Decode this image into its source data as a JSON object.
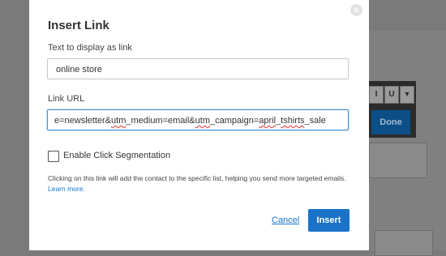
{
  "background": {
    "format_buttons": [
      "I",
      "U",
      "▾"
    ],
    "done_label": "Done"
  },
  "modal": {
    "title": "Insert Link",
    "display_text_label": "Text to display as link",
    "display_text_value": "online store",
    "url_label": "Link URL",
    "url_value_parts": [
      "e=newsletter&",
      "utm",
      "_medium=email&",
      "utm",
      "_campaign=",
      "april",
      "_",
      "tshirts",
      "_sale"
    ],
    "checkbox_label": "Enable Click Segmentation",
    "checkbox_checked": false,
    "help_text": "Clicking on this link will add the contact to the specific list, helping you send more targeted emails.",
    "learn_more_label": "Learn more.",
    "cancel_label": "Cancel",
    "insert_label": "Insert",
    "close_glyph": "×"
  },
  "colors": {
    "accent": "#1a73c8",
    "overlay": "#7a7a7a",
    "focus_border": "#3d8ed4"
  }
}
